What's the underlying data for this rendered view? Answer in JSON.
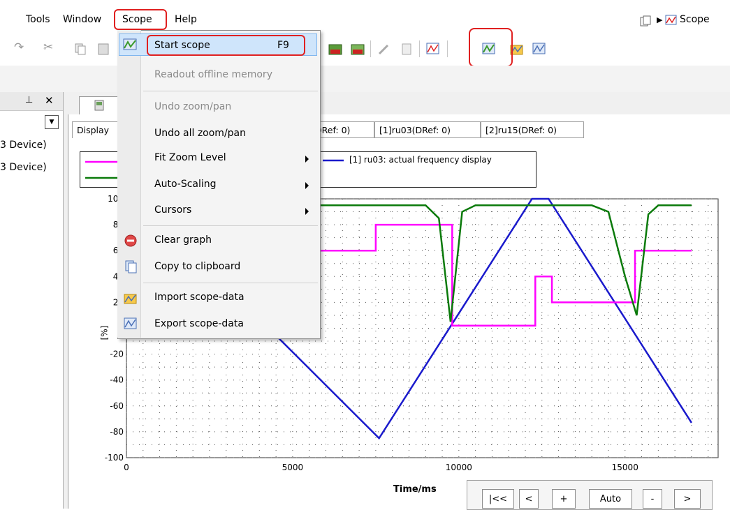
{
  "menubar": {
    "tools": "Tools",
    "window": "Window",
    "scope": "Scope",
    "help": "Help"
  },
  "breadcrumb": {
    "scope": "Scope"
  },
  "left_pane": {
    "pin": "⊥",
    "close": "✕",
    "items": [
      "3 Device)",
      "3 Device)"
    ]
  },
  "tabs": {
    "display": "Display",
    "tab_drefs": "DRef: 0)",
    "tab_ru03": "[1]ru03(DRef: 0)",
    "tab_ru15": "[2]ru15(DRef: 0)"
  },
  "legend": {
    "entry1": "[1] ru03: actual frequency display"
  },
  "menu": {
    "start_scope": "Start scope",
    "start_shortcut": "F9",
    "readout": "Readout offline memory",
    "undo": "Undo zoom/pan",
    "undo_all": "Undo all zoom/pan",
    "fit_zoom": "Fit Zoom Level",
    "auto_scaling": "Auto-Scaling",
    "cursors": "Cursors",
    "clear_graph": "Clear graph",
    "copy_clipboard": "Copy to clipboard",
    "import_data": "Import scope-data",
    "export_data": "Export scope-data"
  },
  "chart_data": {
    "type": "line",
    "xlabel": "Time/ms",
    "ylabel": "[%]",
    "xlim": [
      0,
      17800
    ],
    "ylim": [
      -100,
      100
    ],
    "x_ticks": [
      "0",
      "5000",
      "10000",
      "15000"
    ],
    "y_ticks": [
      "100",
      "80",
      "60",
      "40",
      "20",
      "0",
      "-20",
      "-40",
      "-60",
      "-80",
      "-100"
    ],
    "grid": true,
    "series": [
      {
        "name": "[1] ru03: actual frequency display",
        "color": "#1a1acc",
        "x": [
          3500,
          7600,
          12200,
          12700,
          17000
        ],
        "y": [
          20,
          -85,
          100,
          100,
          -73
        ]
      },
      {
        "color": "#ff00ff",
        "x": [
          5800,
          7500,
          7500,
          9800,
          9800,
          12300,
          12300,
          12800,
          12800,
          15300,
          15300,
          17000
        ],
        "y": [
          60,
          60,
          80,
          80,
          2,
          2,
          40,
          40,
          20,
          20,
          60,
          60
        ]
      },
      {
        "color": "#0a7a0a",
        "x": [
          5800,
          9000,
          9400,
          9750,
          10100,
          10500,
          14000,
          14500,
          15000,
          15350,
          15700,
          16000,
          17000
        ],
        "y": [
          95,
          95,
          85,
          5,
          90,
          95,
          95,
          90,
          40,
          10,
          88,
          95,
          95
        ]
      }
    ]
  },
  "nav": {
    "first": "|<<",
    "prev": "<",
    "zoom_in": "+",
    "auto": "Auto",
    "zoom_out": "-",
    "next": ">"
  },
  "colors": {
    "highlight_red": "#e02020",
    "menu_highlight": "#cfe5fb"
  }
}
